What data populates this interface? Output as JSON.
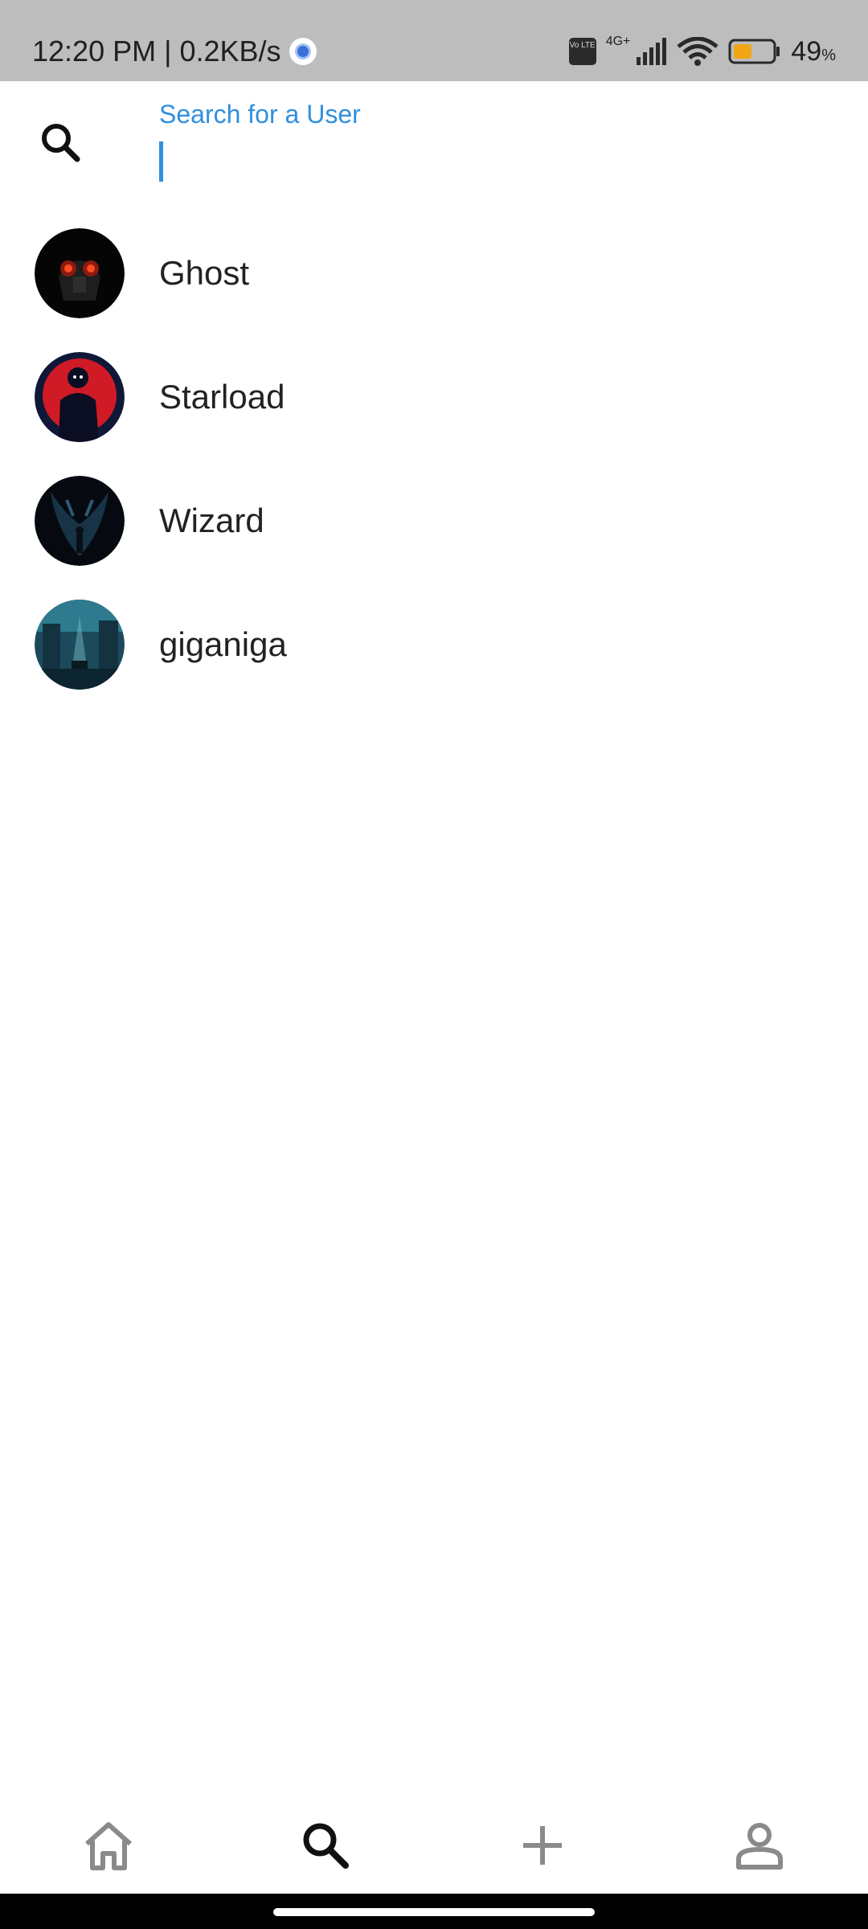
{
  "status_bar": {
    "time_speed": "12:20 PM | 0.2KB/s",
    "volte": "Vo LTE",
    "network": "4G+",
    "battery": "49",
    "battery_unit": "%"
  },
  "search": {
    "label": "Search for a User",
    "value": "",
    "accent_color": "#2f8fdf"
  },
  "users": [
    {
      "name": "Ghost"
    },
    {
      "name": "Starload"
    },
    {
      "name": "Wizard"
    },
    {
      "name": "giganiga"
    }
  ],
  "bottom_nav": [
    {
      "icon": "home-icon",
      "active": false
    },
    {
      "icon": "search-icon",
      "active": true
    },
    {
      "icon": "add-icon",
      "active": false
    },
    {
      "icon": "profile-icon",
      "active": false
    }
  ]
}
